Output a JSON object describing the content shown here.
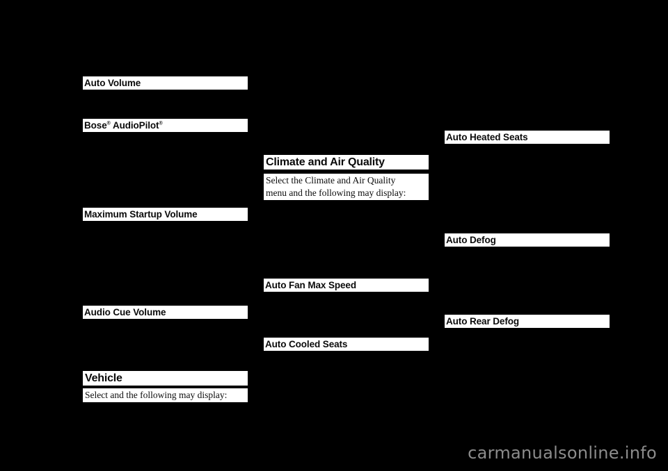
{
  "page": {
    "background_color": "#000000",
    "highlight_color": "#ffffff",
    "text_color": "#0a0a0a",
    "watermark": "carmanualsonline.info",
    "watermark_color": "#8c8c8c"
  },
  "columns": {
    "left": {
      "headings": [
        {
          "id": "auto-volume",
          "label": "Auto Volume"
        },
        {
          "id": "bose-audiopilot",
          "label_parts": {
            "first": "Bose",
            "mark1": "®",
            "middle": " AudioPilot",
            "mark2": "®"
          }
        },
        {
          "id": "maximum-startup-volume",
          "label": "Maximum Startup Volume"
        },
        {
          "id": "audio-cue-volume",
          "label": "Audio Cue Volume"
        },
        {
          "id": "vehicle",
          "label": "Vehicle"
        }
      ],
      "body": {
        "vehicle_intro": "Select and the following may display:"
      }
    },
    "middle": {
      "headings": [
        {
          "id": "climate-and-air-quality",
          "label": "Climate and Air Quality"
        },
        {
          "id": "auto-fan-max-speed",
          "label": "Auto Fan Max Speed"
        },
        {
          "id": "auto-cooled-seats",
          "label": "Auto Cooled Seats"
        }
      ],
      "body": {
        "climate_intro_line1": "Select the Climate and Air Quality",
        "climate_intro_line2": "menu and the following may display:"
      }
    },
    "right": {
      "headings": [
        {
          "id": "auto-heated-seats",
          "label": "Auto Heated Seats"
        },
        {
          "id": "auto-defog",
          "label": "Auto Defog"
        },
        {
          "id": "auto-rear-defog",
          "label": "Auto Rear Defog"
        }
      ]
    }
  }
}
